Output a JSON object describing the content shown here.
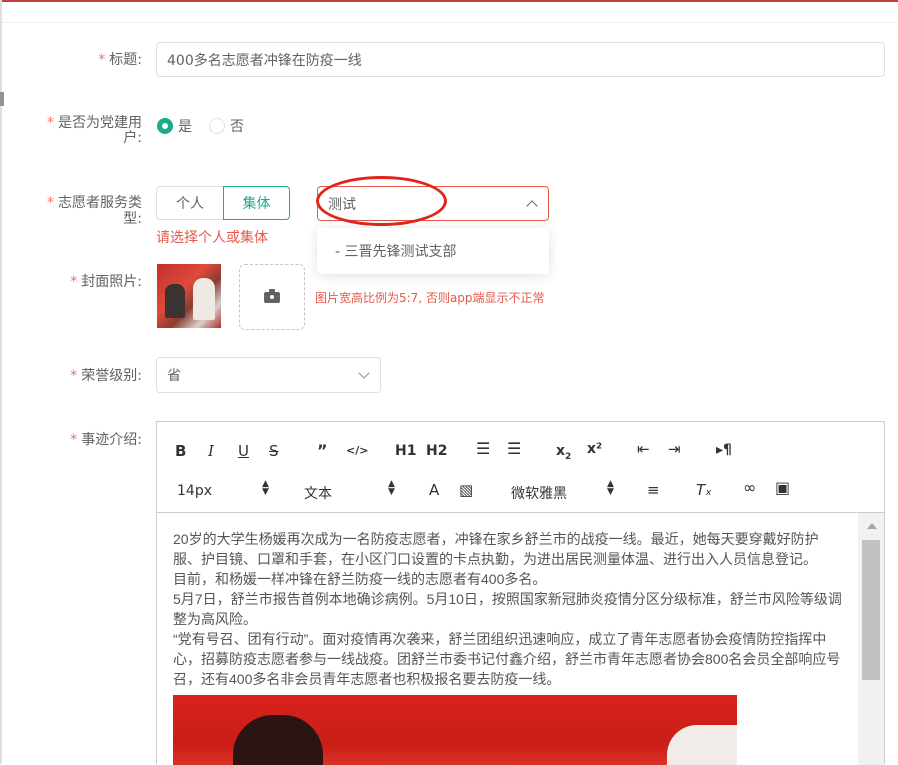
{
  "form": {
    "title": {
      "label": "标题:",
      "required_mark": "*",
      "value": "400多名志愿者冲锋在防疫一线"
    },
    "party_user": {
      "label": "是否为党建用户:",
      "required_mark": "*",
      "options": [
        {
          "label": "是",
          "checked": true
        },
        {
          "label": "否",
          "checked": false
        }
      ]
    },
    "service_type": {
      "label": "志愿者服务类型:",
      "required_mark": "*",
      "buttons": [
        {
          "label": "个人",
          "active": false
        },
        {
          "label": "集体",
          "active": true
        }
      ],
      "select_value": "测试",
      "dropdown_options": [
        "- 三晋先锋测试支部"
      ],
      "error": "请选择个人或集体"
    },
    "cover": {
      "label": "封面照片:",
      "required_mark": "*",
      "hint": "图片宽高比例为5:7, 否则app端显示不正常"
    },
    "honor_level": {
      "label": "荣誉级别:",
      "required_mark": "*",
      "value": "省"
    },
    "story": {
      "label": "事迹介绍:",
      "required_mark": "*"
    }
  },
  "editor": {
    "toolbar_row1": [
      "B",
      "I",
      "U",
      "S",
      "99",
      "</>",
      "H1",
      "H2",
      "ol",
      "ul",
      "x2",
      "x²",
      "outdent",
      "indent",
      "¶"
    ],
    "font_size": "14px",
    "block_type": "文本",
    "font_family": "微软雅黑",
    "paragraphs": [
      "20岁的大学生杨媛再次成为一名防疫志愿者，冲锋在家乡舒兰市的战疫一线。最近，她每天要穿戴好防护服、护目镜、口罩和手套，在小区门口设置的卡点执勤，为进出居民测量体温、进行出入人员信息登记。",
      "目前，和杨媛一样冲锋在舒兰防疫一线的志愿者有400多名。",
      "5月7日，舒兰市报告首例本地确诊病例。5月10日，按照国家新冠肺炎疫情分区分级标准，舒兰市风险等级调整为高风险。",
      "“党有号召、团有行动”。面对疫情再次袭来，舒兰团组织迅速响应，成立了青年志愿者协会疫情防控指挥中心，招募防疫志愿者参与一线战疫。团舒兰市委书记付鑫介绍，舒兰市青年志愿者协会800名会员全部响应号召，还有400多名非会员青年志愿者也积极报名要去防疫一线。"
    ]
  },
  "colors": {
    "accent": "#1aad8e",
    "error": "#e35a4a",
    "required": "#f56c6c"
  }
}
